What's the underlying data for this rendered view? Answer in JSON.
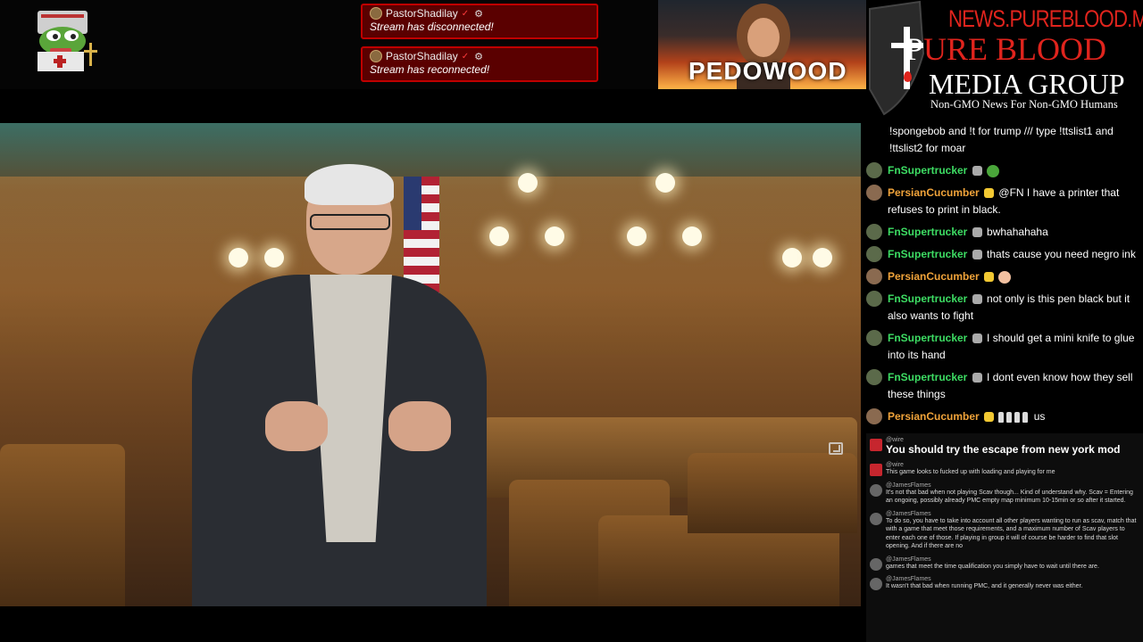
{
  "alerts": [
    {
      "user": "PastorShadilay",
      "text": "Stream has disconnected!"
    },
    {
      "user": "PastorShadilay",
      "text": "Stream has reconnected!"
    }
  ],
  "thumbnail": {
    "text": "PEDOWOOD"
  },
  "brand": {
    "url": "NEWS.PUREBLOOD.MEDIA",
    "line1_white": "P",
    "line1_red": "URE BLOOD",
    "line2": "MEDIA GROUP",
    "tagline": "Non-GMO News For Non-GMO Humans"
  },
  "chat": [
    {
      "user": "",
      "text": "!spongebob and !t for trump /// type !ttslist1 and !ttslist2 for moar"
    },
    {
      "user": "FnSupertrucker",
      "text": ""
    },
    {
      "user": "PersianCucumber",
      "text": "@FN I have a printer that refuses to print in black."
    },
    {
      "user": "FnSupertrucker",
      "text": "bwhahahaha"
    },
    {
      "user": "FnSupertrucker",
      "text": "thats cause you need negro ink"
    },
    {
      "user": "PersianCucumber",
      "text": ""
    },
    {
      "user": "FnSupertrucker",
      "text": "not only is this pen black but it also wants to fight"
    },
    {
      "user": "FnSupertrucker",
      "text": "I should get a mini knife to glue into its hand"
    },
    {
      "user": "FnSupertrucker",
      "text": "I dont even know how they sell these things"
    },
    {
      "user": "PersianCucumber",
      "text": "us"
    }
  ],
  "ytchat": [
    {
      "user": "@wire",
      "text": "You should try the escape from new york mod"
    },
    {
      "user": "@wire",
      "text": "This game looks to fucked up with loading and playing for me"
    },
    {
      "user": "@JamesFlames",
      "text": "It's not that bad when not playing Scav though... Kind of understand why. Scav = Entering an ongoing, possibly already PMC empty map minimum 10-15min or so after it started."
    },
    {
      "user": "@JamesFlames",
      "text": "To do so, you have to take into account all other players wanting to run as scav, match that with a game that meet those requirements, and a maximum number of Scav players to enter each one of those. If playing in group it will of course be harder to find that slot opening. And if there are no"
    },
    {
      "user": "@JamesFlames",
      "text": "games that meet the time qualification you simply have to wait until there are."
    },
    {
      "user": "@JamesFlames",
      "text": "It wasn't that bad when running PMC, and it generally never was either."
    }
  ]
}
